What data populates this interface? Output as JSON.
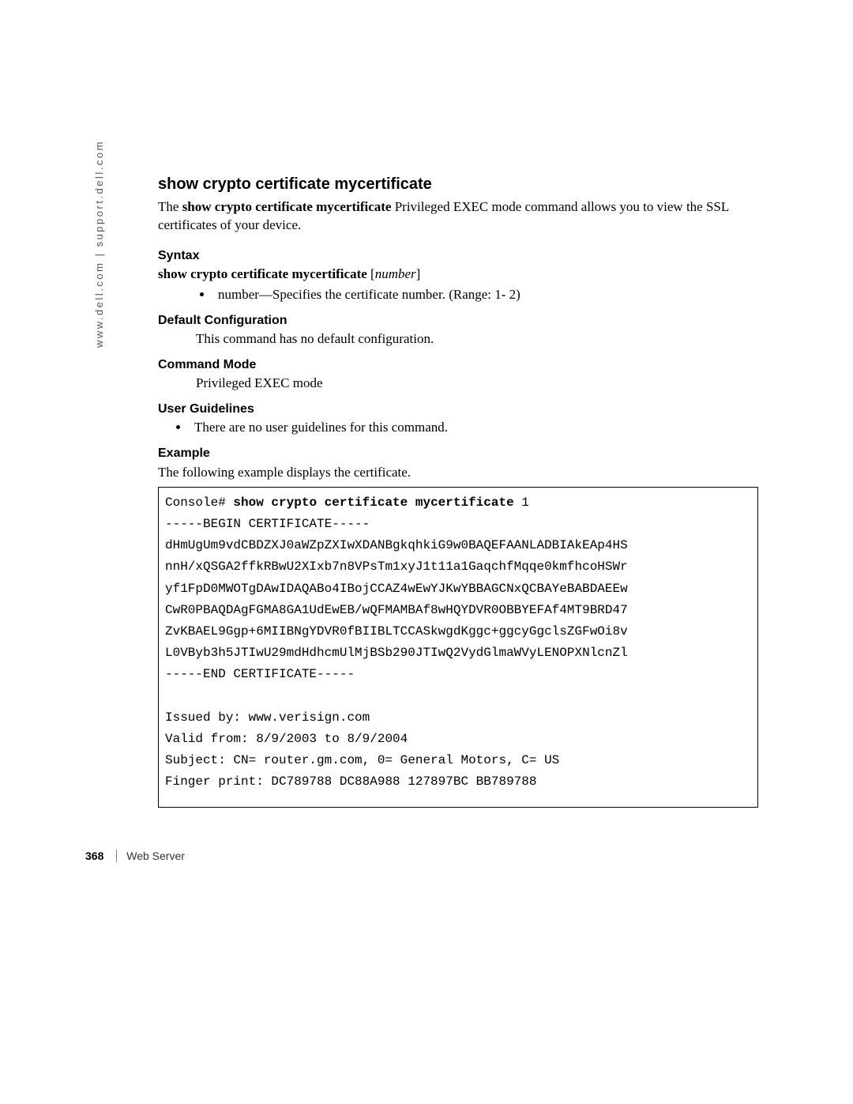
{
  "side_url": "www.dell.com | support.dell.com",
  "title": "show crypto certificate mycertificate",
  "intro_pre": "The ",
  "intro_bold": "show crypto certificate mycertificate",
  "intro_post": " Privileged EXEC mode command allows you to view the SSL certificates of your device.",
  "syntax": {
    "heading": "Syntax",
    "line_bold": "show crypto certificate mycertificate",
    "line_plain": " [",
    "line_italic": "number",
    "line_end": "]",
    "bullet": "number—Specifies the certificate number. (Range: 1- 2)"
  },
  "default_cfg": {
    "heading": "Default Configuration",
    "text": "This command has no default configuration."
  },
  "cmd_mode": {
    "heading": "Command Mode",
    "text": "Privileged EXEC mode"
  },
  "user_guidelines": {
    "heading": "User Guidelines",
    "bullet": "There are no user guidelines for this command."
  },
  "example": {
    "heading": "Example",
    "lead": "The following example displays the certificate.",
    "prompt": "Console# ",
    "cmd_bold": "show crypto certificate mycertificate",
    "cmd_arg": " 1",
    "lines": [
      "-----BEGIN CERTIFICATE-----",
      "dHmUgUm9vdCBDZXJ0aWZpZXIwXDANBgkqhkiG9w0BAQEFAANLADBIAkEAp4HS",
      "nnH/xQSGA2ffkRBwU2XIxb7n8VPsTm1xyJ1t11a1GaqchfMqqe0kmfhcoHSWr",
      "yf1FpD0MWOTgDAwIDAQABo4IBojCCAZ4wEwYJKwYBBAGCNxQCBAYeBABDAEEw",
      "CwR0PBAQDAgFGMA8GA1UdEwEB/wQFMAMBAf8wHQYDVR0OBBYEFAf4MT9BRD47",
      "ZvKBAEL9Ggp+6MIIBNgYDVR0fBIIBLTCCASkwgdKggc+ggcyGgclsZGFwOi8v",
      "L0VByb3h5JTIwU29mdHdhcmUlMjBSb290JTIwQ2VydGlmaWVyLENOPXNlcnZl",
      "-----END CERTIFICATE-----",
      "",
      "Issued by: www.verisign.com",
      "Valid from: 8/9/2003 to 8/9/2004",
      "Subject: CN= router.gm.com, 0= General Motors, C= US",
      "Finger print: DC789788 DC88A988 127897BC BB789788"
    ]
  },
  "footer": {
    "page": "368",
    "section": "Web Server"
  }
}
